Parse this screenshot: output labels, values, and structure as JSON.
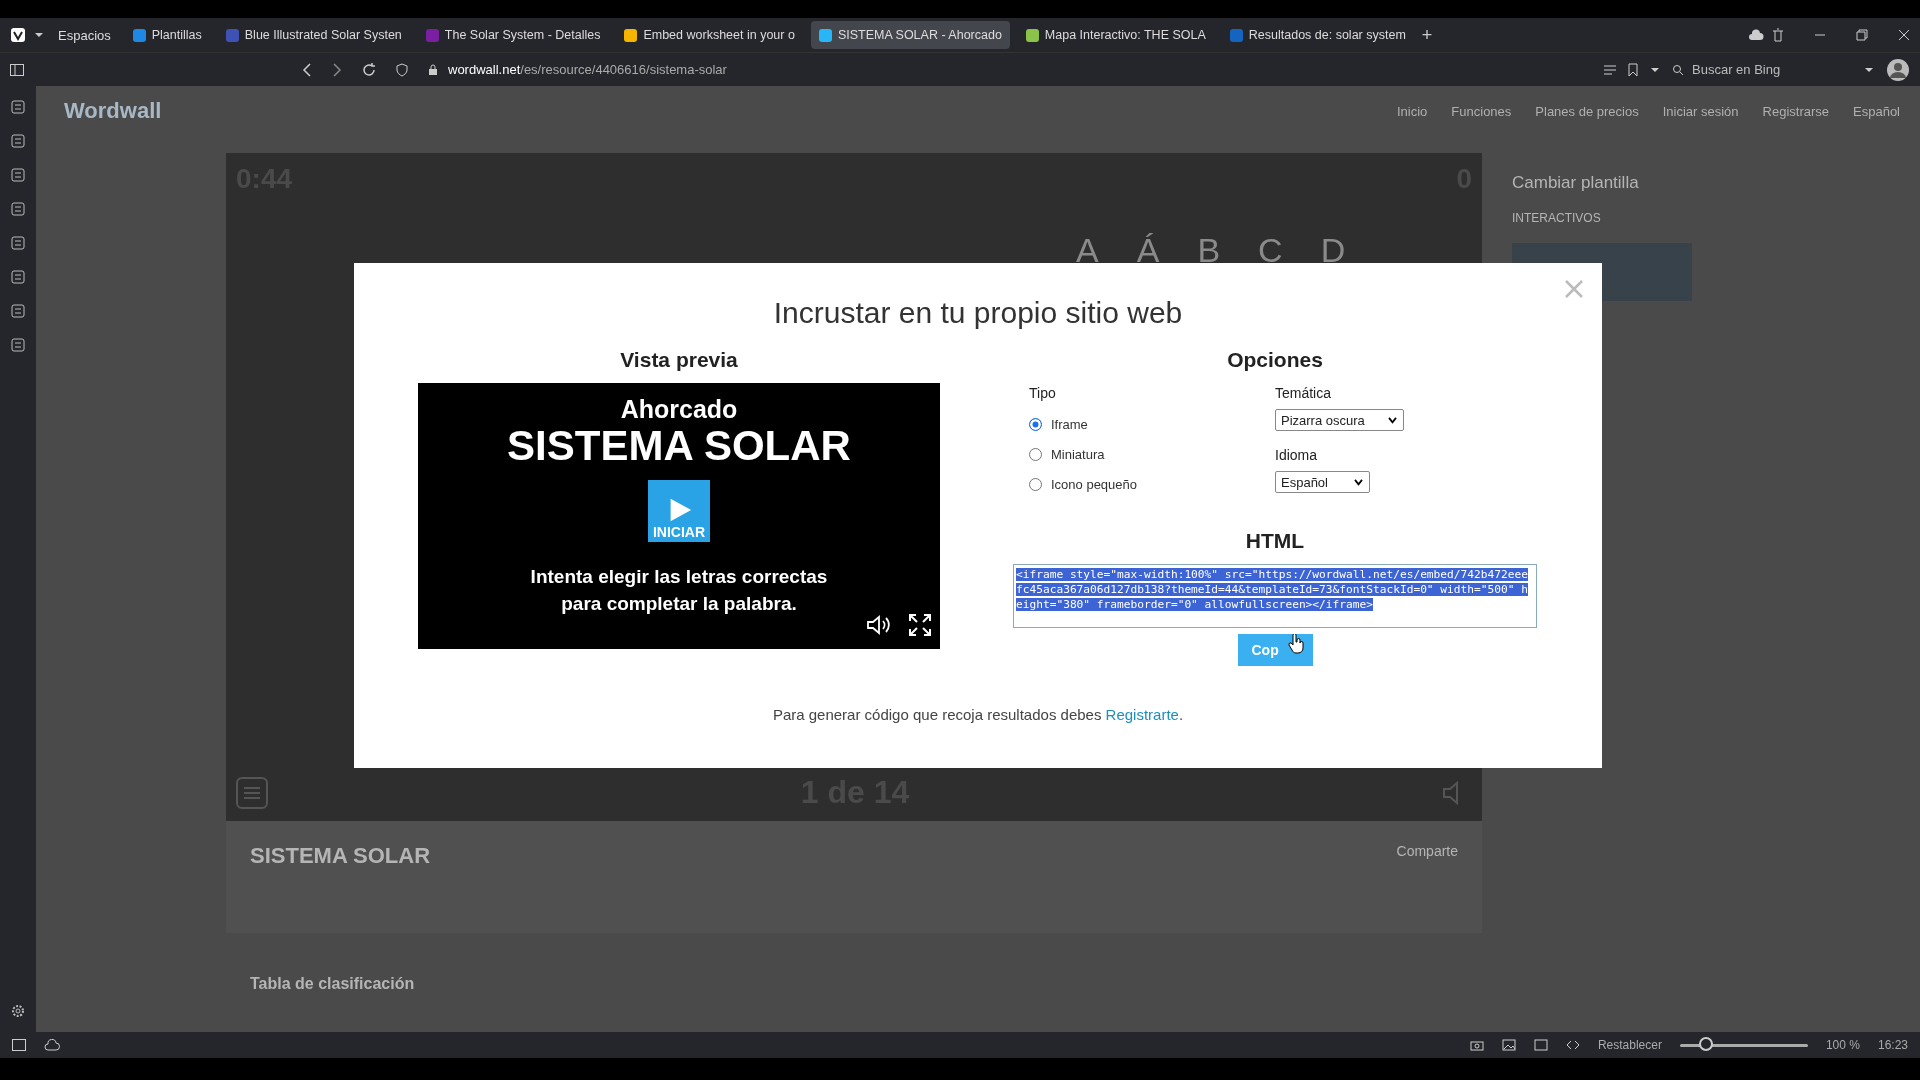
{
  "browser": {
    "workspaces": "Espacios",
    "tabs": [
      {
        "label": "Plantillas",
        "selected": false,
        "color": "#1e88e5"
      },
      {
        "label": "Blue Illustrated Solar Systen",
        "selected": false,
        "color": "#3f51b5"
      },
      {
        "label": "The Solar System - Detalles",
        "selected": false,
        "color": "#7b1fa2"
      },
      {
        "label": "Embed worksheet in your o",
        "selected": false,
        "color": "#f4b400"
      },
      {
        "label": "SISTEMA SOLAR - Ahorcado",
        "selected": true,
        "color": "#29b6f6"
      },
      {
        "label": "Mapa Interactivo: THE SOLA",
        "selected": false,
        "color": "#8bc34a"
      },
      {
        "label": "Resultados de: solar system",
        "selected": false,
        "color": "#1565c0"
      }
    ],
    "new_tab": "+",
    "url_host": "wordwall.net",
    "url_path": "/es/resource/4406616/sistema-solar",
    "search_placeholder": "Buscar en Bing"
  },
  "page": {
    "logo": "Wordwall",
    "nav": [
      "Inicio",
      "Funciones",
      "Planes de precios",
      "Iniciar sesión",
      "Registrarse",
      "Español"
    ],
    "game": {
      "timer": "0:44",
      "score": "0",
      "letters": [
        "A",
        "Á",
        "B",
        "C",
        "D"
      ],
      "pager": "1 de 14"
    },
    "title": "SISTEMA SOLAR",
    "share": "Comparte",
    "leaderboard": "Tabla de clasificación",
    "side_heading": "Cambiar plantilla",
    "side_label": "INTERACTIVOS"
  },
  "modal": {
    "title": "Incrustar en tu propio sitio web",
    "preview": {
      "heading": "Vista previa",
      "game_type": "Ahorcado",
      "game_title": "SISTEMA SOLAR",
      "start": "INICIAR",
      "instructions": "Intenta elegir las letras correctas para completar la palabra."
    },
    "options": {
      "heading": "Opciones",
      "type_label": "Tipo",
      "types": [
        {
          "label": "Iframe",
          "selected": true
        },
        {
          "label": "Miniatura",
          "selected": false
        },
        {
          "label": "Icono pequeño",
          "selected": false
        }
      ],
      "theme_label": "Temática",
      "theme": "Pizarra oscura",
      "language_label": "Idioma",
      "language": "Español"
    },
    "html_heading": "HTML",
    "code": "<iframe style=\"max-width:100%\" src=\"https://wordwall.net/es/embed/742b472eeefc45aca367a06d127db138?themeId=44&templateId=73&fontStackId=0\" width=\"500\" height=\"380\" frameborder=\"0\" allowfullscreen></iframe>",
    "copy": "Cop",
    "footer": "Para generar código que recoja resultados debes",
    "footer_link": "Registrarte",
    "footer_end": "."
  },
  "status": {
    "reset": "Restablecer",
    "zoom": {
      "level": 0.2
    },
    "zoom_text": "100 %",
    "time": "16:23"
  }
}
